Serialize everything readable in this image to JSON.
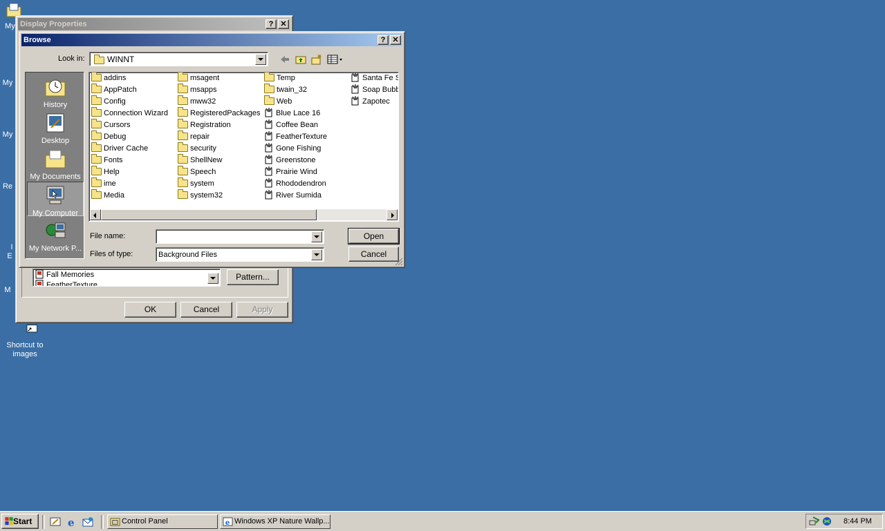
{
  "desktop": {
    "icons": [
      {
        "label": "My D",
        "icon": "my-documents-icon"
      },
      {
        "label": "My",
        "icon": "my-computer-icon"
      },
      {
        "label": "My",
        "icon": "my-network-icon"
      },
      {
        "label": "Re",
        "icon": "recycle-bin-icon"
      },
      {
        "label": "I\nE",
        "icon": "internet-explorer-icon"
      },
      {
        "label": "M",
        "icon": "media-icon"
      },
      {
        "label": "Shortcut to images",
        "icon": "shortcut-icon"
      }
    ]
  },
  "display_properties": {
    "title": "Display Properties",
    "help_button": "?",
    "close_button": "✕",
    "wallpaper_list": [
      "Fall Memories",
      "FeatherTexture"
    ],
    "pattern_button": "Pattern...",
    "ok_button": "OK",
    "cancel_button": "Cancel",
    "apply_button": "Apply"
  },
  "browse": {
    "title": "Browse",
    "help_button": "?",
    "close_button": "✕",
    "look_in_label": "Look in:",
    "look_in_value": "WINNT",
    "places": [
      {
        "label": "History",
        "icon": "history-icon"
      },
      {
        "label": "Desktop",
        "icon": "desktop-icon"
      },
      {
        "label": "My Documents",
        "icon": "my-documents-icon"
      },
      {
        "label": "My Computer",
        "icon": "my-computer-icon",
        "selected": true
      },
      {
        "label": "My Network P...",
        "icon": "network-places-icon"
      }
    ],
    "columns": [
      [
        {
          "name": "addins",
          "type": "folder"
        },
        {
          "name": "AppPatch",
          "type": "folder"
        },
        {
          "name": "Config",
          "type": "folder"
        },
        {
          "name": "Connection Wizard",
          "type": "folder"
        },
        {
          "name": "Cursors",
          "type": "folder"
        },
        {
          "name": "Debug",
          "type": "folder"
        },
        {
          "name": "Driver Cache",
          "type": "folder"
        },
        {
          "name": "Fonts",
          "type": "folder"
        },
        {
          "name": "Help",
          "type": "folder"
        },
        {
          "name": "ime",
          "type": "folder"
        },
        {
          "name": "Media",
          "type": "folder"
        }
      ],
      [
        {
          "name": "msagent",
          "type": "folder"
        },
        {
          "name": "msapps",
          "type": "folder"
        },
        {
          "name": "mww32",
          "type": "folder"
        },
        {
          "name": "RegisteredPackages",
          "type": "folder"
        },
        {
          "name": "Registration",
          "type": "folder"
        },
        {
          "name": "repair",
          "type": "folder"
        },
        {
          "name": "security",
          "type": "folder"
        },
        {
          "name": "ShellNew",
          "type": "folder"
        },
        {
          "name": "Speech",
          "type": "folder"
        },
        {
          "name": "system",
          "type": "folder"
        },
        {
          "name": "system32",
          "type": "folder"
        }
      ],
      [
        {
          "name": "Temp",
          "type": "folder"
        },
        {
          "name": "twain_32",
          "type": "folder"
        },
        {
          "name": "Web",
          "type": "folder"
        },
        {
          "name": "Blue Lace 16",
          "type": "wallpaper"
        },
        {
          "name": "Coffee Bean",
          "type": "wallpaper"
        },
        {
          "name": "FeatherTexture",
          "type": "wallpaper"
        },
        {
          "name": "Gone Fishing",
          "type": "wallpaper"
        },
        {
          "name": "Greenstone",
          "type": "wallpaper"
        },
        {
          "name": "Prairie Wind",
          "type": "wallpaper"
        },
        {
          "name": "Rhododendron",
          "type": "wallpaper"
        },
        {
          "name": "River Sumida",
          "type": "wallpaper"
        }
      ],
      [
        {
          "name": "Santa Fe St",
          "type": "wallpaper"
        },
        {
          "name": "Soap Bubbl",
          "type": "wallpaper"
        },
        {
          "name": "Zapotec",
          "type": "wallpaper"
        }
      ]
    ],
    "file_name_label": "File name:",
    "file_name_value": "",
    "files_of_type_label": "Files of type:",
    "files_of_type_value": "Background Files",
    "open_button": "Open",
    "cancel_button": "Cancel"
  },
  "taskbar": {
    "start_label": "Start",
    "quick_launch": [
      "show-desktop-icon",
      "internet-explorer-icon",
      "outlook-express-icon"
    ],
    "tasks": [
      {
        "label": "Control Panel",
        "icon": "control-panel-icon"
      },
      {
        "label": "Windows XP Nature Wallp...",
        "icon": "browser-window-icon"
      }
    ],
    "clock": "8:44 PM"
  },
  "colors": {
    "desktop": "#3a6ea5",
    "active_title": "#0a246a",
    "face": "#d4d0c8"
  }
}
